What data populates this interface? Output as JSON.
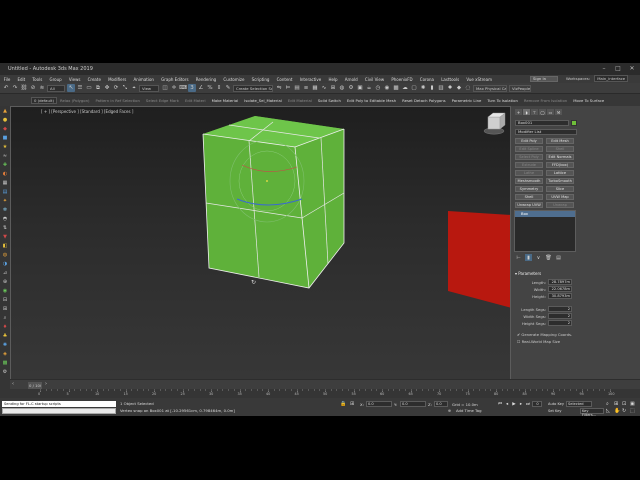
{
  "app": {
    "title": "Untitled - Autodesk 3ds Max 2019"
  },
  "menu": [
    "File",
    "Edit",
    "Tools",
    "Group",
    "Views",
    "Create",
    "Modifiers",
    "Animation",
    "Graph Editors",
    "Rendering",
    "Customize",
    "Scripting",
    "Content",
    "Interactive",
    "Help",
    "Arnold",
    "Civil View",
    "PhoenixFD",
    "Corona",
    "Lasttools",
    "Vue xStream"
  ],
  "signin": {
    "label": "Sign In"
  },
  "workspaces": {
    "label": "Workspaces:",
    "value": "Main_interface"
  },
  "toolbar": {
    "selection_filter": "All",
    "view_dropdown": "View",
    "selection_set": "Create Selection Se",
    "layer": "0 (default)",
    "physical_camera_btn": "Max Physical Camera",
    "people_btn": "VizPeople"
  },
  "ribbon": {
    "items": [
      "Relax (Polygon)",
      "Pattern in Ref Selection",
      "Select Edge Mark",
      "Edit Materi",
      "Make Material",
      "Isolate_Sel_Material",
      "Edit Material",
      "Solid Switch",
      "Edit Poly to Editable Mesh",
      "Reset Detach Polygons",
      "Parametric Line",
      "Turn To Isolation",
      "Remove From Isolation",
      "Move To Surface"
    ]
  },
  "viewport": {
    "label": "[ + ] [Perspective ] [Standard ] [Edged Faces ]"
  },
  "command_panel": {
    "object_name": "Box001",
    "object_color": "#6fbf3a",
    "modifier_list": "Modifier List",
    "buttons": [
      {
        "label": "Edit Poly",
        "dim": false
      },
      {
        "label": "Edit Mesh",
        "dim": false
      },
      {
        "label": "Edit Spline",
        "dim": true
      },
      {
        "label": "Shell",
        "dim": true
      },
      {
        "label": "Select Poly",
        "dim": true
      },
      {
        "label": "Edit Normals",
        "dim": false
      },
      {
        "label": "Extrude",
        "dim": true
      },
      {
        "label": "FFD(box)",
        "dim": false
      },
      {
        "label": "Lathe",
        "dim": true
      },
      {
        "label": "Lattice",
        "dim": false
      },
      {
        "label": "Meshsmooth",
        "dim": false
      },
      {
        "label": "TurboSmooth",
        "dim": false
      },
      {
        "label": "Symmetry",
        "dim": false
      },
      {
        "label": "Slice",
        "dim": false
      },
      {
        "label": "Shell",
        "dim": false
      },
      {
        "label": "UVW Map",
        "dim": false
      },
      {
        "label": "Unwrap UVW",
        "dim": false
      },
      {
        "label": "Unwrap",
        "dim": true
      }
    ],
    "stack_items": [
      "Box"
    ],
    "rollout_title": "Parameters",
    "params": [
      {
        "label": "Length:",
        "value": "28.7897m"
      },
      {
        "label": "Width:",
        "value": "22.0678m"
      },
      {
        "label": "Height:",
        "value": "30.8793m"
      }
    ],
    "segs": [
      {
        "label": "Length Segs:",
        "value": "2"
      },
      {
        "label": "Width Segs:",
        "value": "2"
      },
      {
        "label": "Height Segs:",
        "value": "2"
      }
    ],
    "checks": [
      "Generate Mapping Coords.",
      "Real-World Map Size"
    ]
  },
  "timeline": {
    "frame_display": "0 / 100",
    "ticks": [
      "0",
      "5",
      "10",
      "15",
      "20",
      "25",
      "30",
      "35",
      "40",
      "45",
      "50",
      "55",
      "60",
      "65",
      "70",
      "75",
      "80",
      "85",
      "90",
      "95",
      "100"
    ]
  },
  "status": {
    "maxscript_text": "Sending for FL-C startup scripts",
    "selection_count": "1 Object Selected",
    "prompt": "Vertex snap on Box001 at [-10.29561cm, 0.798464m, 0.0m]",
    "x_label": "X:",
    "x_value": "0.0",
    "y_label": "Y:",
    "y_value": "0.0",
    "z_label": "Z:",
    "z_value": "0.0",
    "grid": "Grid = 10.0m",
    "add_time_tag": "Add Time Tag",
    "auto_key": "Auto Key",
    "set_key": "Set Key",
    "selected": "Selected",
    "key_filters": "Key Filters...",
    "frame_field": "0"
  }
}
